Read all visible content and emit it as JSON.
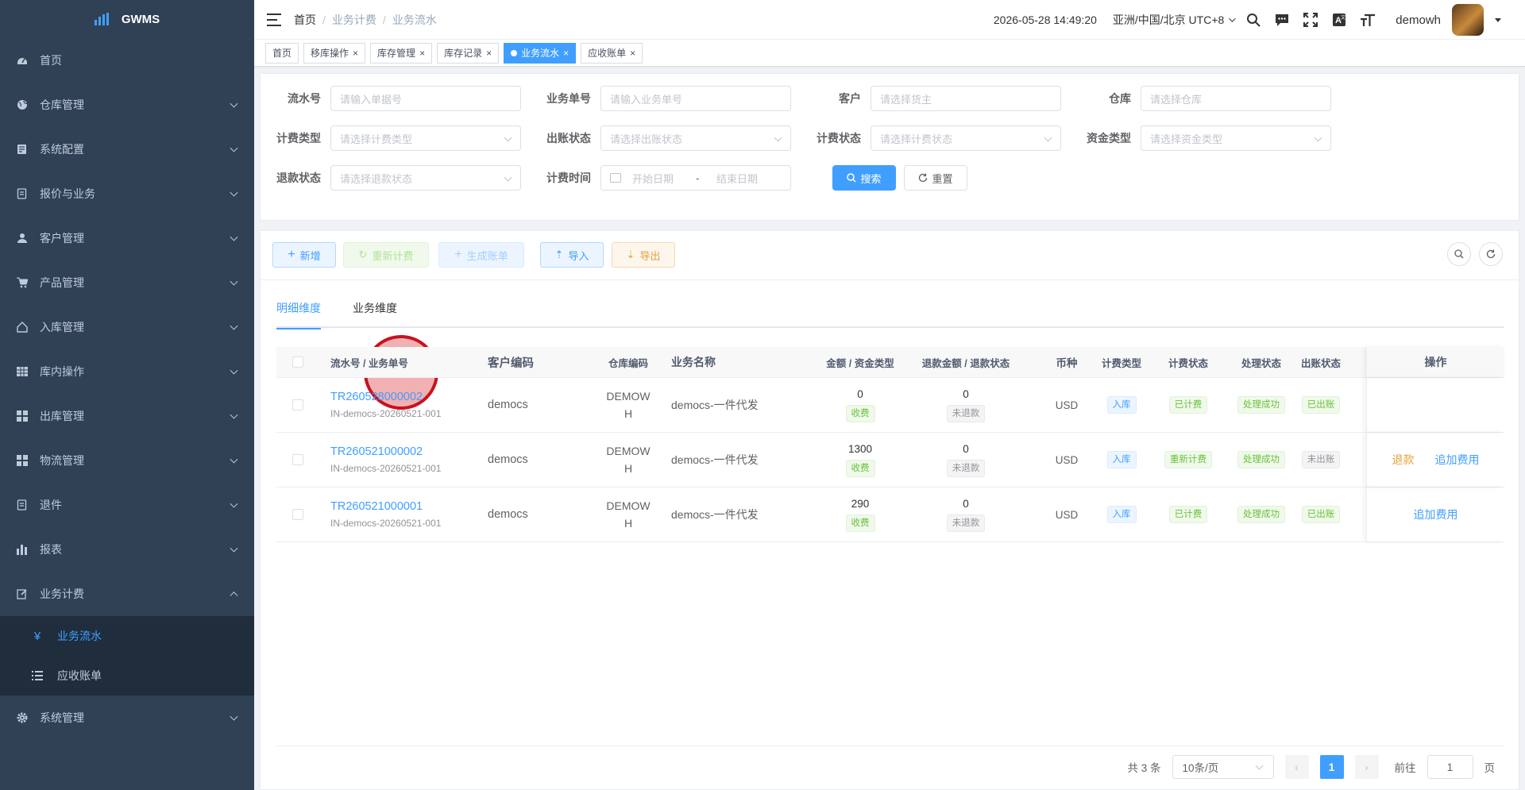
{
  "app": {
    "title": "GWMS"
  },
  "sidebar": {
    "items": [
      {
        "label": "首页",
        "icon": "dashboard-icon"
      },
      {
        "label": "仓库管理",
        "icon": "globe-icon"
      },
      {
        "label": "系统配置",
        "icon": "config-icon"
      },
      {
        "label": "报价与业务",
        "icon": "quote-icon"
      },
      {
        "label": "客户管理",
        "icon": "user-icon"
      },
      {
        "label": "产品管理",
        "icon": "cart-icon"
      },
      {
        "label": "入库管理",
        "icon": "home-icon"
      },
      {
        "label": "库内操作",
        "icon": "grid-icon"
      },
      {
        "label": "出库管理",
        "icon": "apps-icon"
      },
      {
        "label": "物流管理",
        "icon": "apps-icon"
      },
      {
        "label": "退件",
        "icon": "return-icon"
      },
      {
        "label": "报表",
        "icon": "chart-icon"
      },
      {
        "label": "业务计费",
        "icon": "edit-icon"
      }
    ],
    "sub_items": [
      {
        "label": "业务流水",
        "icon": "yen-icon"
      },
      {
        "label": "应收账单",
        "icon": "list-icon"
      }
    ],
    "last_item": {
      "label": "系统管理",
      "icon": "gear-icon"
    }
  },
  "navbar": {
    "breadcrumb": [
      "首页",
      "业务计费",
      "业务流水"
    ],
    "datetime": "2026-05-28 14:49:20",
    "timezone": "亚洲/中国/北京 UTC+8",
    "username": "demowh"
  },
  "tags": [
    {
      "label": "首页",
      "closable": false
    },
    {
      "label": "移库操作",
      "closable": true
    },
    {
      "label": "库存管理",
      "closable": true
    },
    {
      "label": "库存记录",
      "closable": true
    },
    {
      "label": "业务流水",
      "closable": true,
      "active": true
    },
    {
      "label": "应收账单",
      "closable": true
    }
  ],
  "filters": {
    "serial_no": {
      "label": "流水号",
      "placeholder": "请输入单据号"
    },
    "biz_no": {
      "label": "业务单号",
      "placeholder": "请输入业务单号"
    },
    "customer": {
      "label": "客户",
      "placeholder": "请选择货主"
    },
    "warehouse": {
      "label": "仓库",
      "placeholder": "请选择仓库"
    },
    "fee_type": {
      "label": "计费类型",
      "placeholder": "请选择计费类型"
    },
    "invoice_status": {
      "label": "出账状态",
      "placeholder": "请选择出账状态"
    },
    "fee_status": {
      "label": "计费状态",
      "placeholder": "请选择计费状态"
    },
    "fund_type": {
      "label": "资金类型",
      "placeholder": "请选择资金类型"
    },
    "refund_status": {
      "label": "退款状态",
      "placeholder": "请选择退款状态"
    },
    "fee_time": {
      "label": "计费时间",
      "start_placeholder": "开始日期",
      "separator": "-",
      "end_placeholder": "结束日期"
    },
    "search_label": "搜索",
    "reset_label": "重置"
  },
  "toolbar": {
    "add_label": "新增",
    "recalc_label": "重新计费",
    "gen_bill_label": "生成账单",
    "import_label": "导入",
    "export_label": "导出"
  },
  "tabs": [
    {
      "label": "明细维度",
      "active": true
    },
    {
      "label": "业务维度",
      "active": false
    }
  ],
  "table": {
    "headers": [
      "流水号 / 业务单号",
      "客户编码",
      "仓库编码",
      "业务名称",
      "金额 / 资金类型",
      "退款金额 / 退款状态",
      "币种",
      "计费类型",
      "计费状态",
      "处理状态",
      "出账状态",
      "操作"
    ],
    "rows": [
      {
        "serial": "TR260528000002",
        "biz": "IN-democs-20260521-001",
        "customer": "democs",
        "wh1": "DEMOW",
        "wh2": "H",
        "name": "democs-一件代发",
        "amount": "0",
        "fund": "收费",
        "refund": "0",
        "refund_status": "未退款",
        "currency": "USD",
        "fee_type": "入库",
        "fee_status": "已计费",
        "proc_status": "处理成功",
        "invoice_status": "已出账",
        "ops": []
      },
      {
        "serial": "TR260521000002",
        "biz": "IN-democs-20260521-001",
        "customer": "democs",
        "wh1": "DEMOW",
        "wh2": "H",
        "name": "democs-一件代发",
        "amount": "1300",
        "fund": "收费",
        "refund": "0",
        "refund_status": "未退款",
        "currency": "USD",
        "fee_type": "入库",
        "fee_status": "重新计费",
        "proc_status": "处理成功",
        "invoice_status": "未出账",
        "ops": [
          "退款",
          "追加费用"
        ]
      },
      {
        "serial": "TR260521000001",
        "biz": "IN-democs-20260521-001",
        "customer": "democs",
        "wh1": "DEMOW",
        "wh2": "H",
        "name": "democs-一件代发",
        "amount": "290",
        "fund": "收费",
        "refund": "0",
        "refund_status": "未退款",
        "currency": "USD",
        "fee_type": "入库",
        "fee_status": "已计费",
        "proc_status": "处理成功",
        "invoice_status": "已出账",
        "ops": [
          "追加费用"
        ]
      }
    ]
  },
  "pagination": {
    "total_text": "共 3 条",
    "page_size": "10条/页",
    "current": "1",
    "goto_label": "前往",
    "goto_value": "1",
    "page_unit": "页"
  },
  "colors": {
    "primary": "#409eff",
    "sidebar_bg": "#304156",
    "success": "#67c23a",
    "warning": "#e6a23c"
  }
}
